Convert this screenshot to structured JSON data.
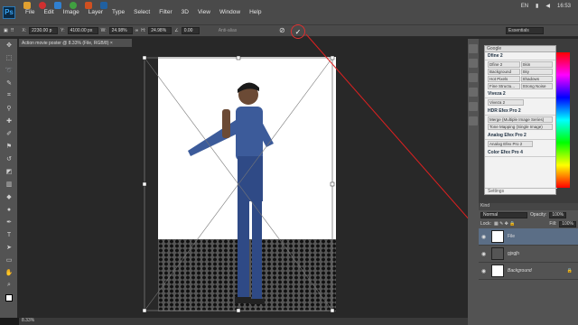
{
  "menubar": {
    "logo": "Ps",
    "items": [
      "File",
      "Edit",
      "Image",
      "Layer",
      "Type",
      "Select",
      "Filter",
      "3D",
      "View",
      "Window",
      "Help"
    ]
  },
  "tray": {
    "lang": "EN",
    "time": "16:53"
  },
  "options": {
    "x_label": "X:",
    "x_value": "2230.00 p",
    "y_label": "Y:",
    "y_value": "4100.00 px",
    "w_label": "W:",
    "w_value": "24.98%",
    "h_label": "H:",
    "h_value": "24.98%",
    "angle_label": "∠",
    "angle_value": "0.00",
    "antialias": "Anti-alias",
    "workspace": "Essentials"
  },
  "doc_tab": "Action movie poster @ 8.33% (File, RGB/8) ×",
  "status": "8.33%",
  "google": {
    "title": "Google",
    "dfine": {
      "title": "Dfine 2",
      "buttons": [
        "Dfine 2",
        "Skin",
        "Background",
        "Sky",
        "Hot Pixels",
        "Shadows",
        "Fine Structu...",
        "Strong Noise"
      ]
    },
    "viveza": {
      "title": "Viveza 2",
      "buttons": [
        "Viveza 2"
      ]
    },
    "hdr": {
      "title": "HDR Efex Pro 2",
      "buttons": [
        "Merge (Multiple Image Series)",
        "Tone Mapping (Single Image)"
      ]
    },
    "analog": {
      "title": "Analog Efex Pro 2",
      "buttons": [
        "Analog Efex Pro 2"
      ]
    },
    "color": {
      "title": "Color Efex Pro 4"
    },
    "settings": "Settings"
  },
  "layers": {
    "kind": "Kind",
    "mode": "Normal",
    "opacity_label": "Opacity:",
    "opacity": "100%",
    "lock_label": "Lock:",
    "fill_label": "Fill:",
    "fill": "100%",
    "items": [
      {
        "name": "File"
      },
      {
        "name": "gjsgjh"
      },
      {
        "name": "Background"
      }
    ]
  }
}
